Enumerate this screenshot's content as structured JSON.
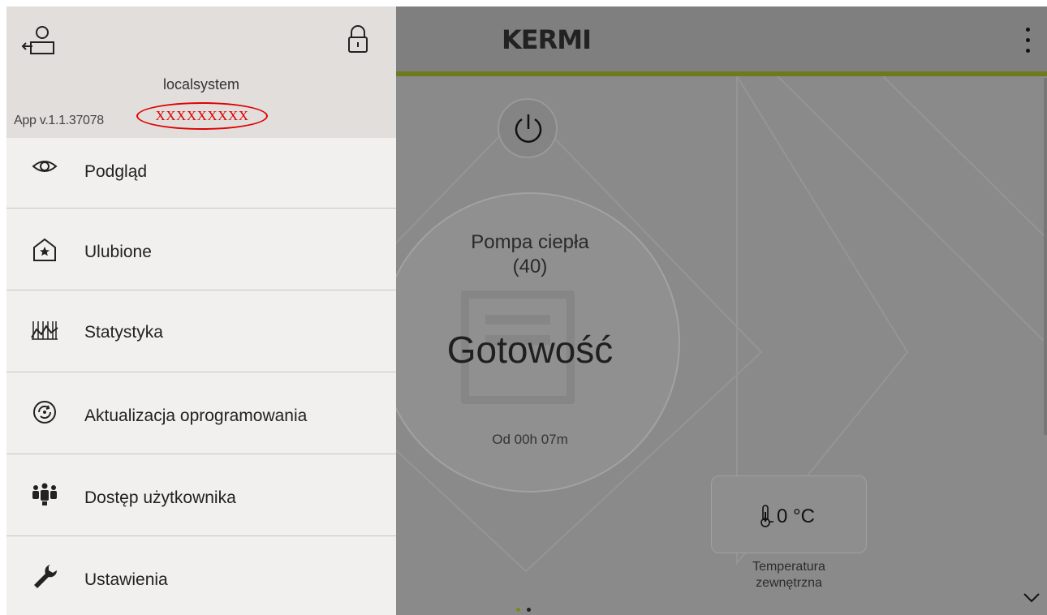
{
  "drawer": {
    "system_name": "localsystem",
    "app_version": "App v.1.1.37078",
    "redacted_text": "XXXXXXXXX",
    "menu": [
      {
        "label": "Podgląd",
        "icon": "eye-icon"
      },
      {
        "label": "Ulubione",
        "icon": "favorite-home-icon"
      },
      {
        "label": "Statystyka",
        "icon": "statistics-icon"
      },
      {
        "label": "Aktualizacja oprogramowania",
        "icon": "software-update-icon"
      },
      {
        "label": "Dostęp użytkownika",
        "icon": "user-access-icon"
      },
      {
        "label": "Ustawienia",
        "icon": "wrench-icon"
      }
    ]
  },
  "header": {
    "logo": "KERMI",
    "accent_color": "#6f7a1e"
  },
  "device": {
    "name": "Pompa ciepła",
    "id": "(40)",
    "status": "Gotowość",
    "since": "Od 00h 07m"
  },
  "temperature": {
    "value": "0 °C",
    "label_line1": "Temperatura",
    "label_line2": "zewnętrzna"
  },
  "pager": {
    "active_index": 0,
    "count": 2,
    "active_color": "#7d8a1a"
  }
}
